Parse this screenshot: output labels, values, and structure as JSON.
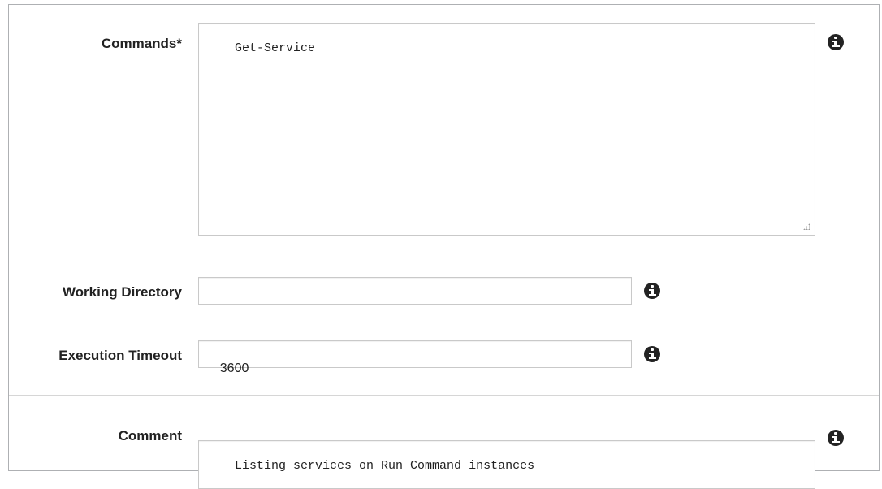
{
  "form": {
    "commands": {
      "label": "Commands*",
      "value": "Get-Service",
      "info_icon": "info-circle-icon"
    },
    "working_directory": {
      "label": "Working Directory",
      "value": "",
      "info_icon": "info-circle-icon"
    },
    "execution_timeout": {
      "label": "Execution Timeout",
      "value": "3600",
      "info_icon": "info-circle-icon"
    },
    "comment": {
      "label": "Comment",
      "value": "Listing services on Run Command instances",
      "info_icon": "info-circle-icon"
    }
  }
}
